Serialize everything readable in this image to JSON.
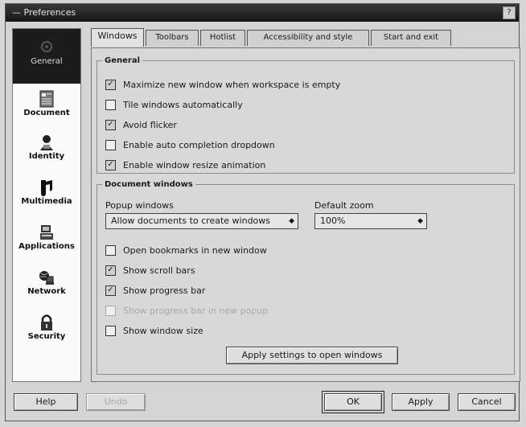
{
  "window": {
    "title": "Preferences",
    "close_label": "?"
  },
  "sidebar": {
    "items": [
      {
        "label": "General",
        "icon": "general-icon"
      },
      {
        "label": "Document",
        "icon": "document-icon"
      },
      {
        "label": "Identity",
        "icon": "identity-icon"
      },
      {
        "label": "Multimedia",
        "icon": "multimedia-icon"
      },
      {
        "label": "Applications",
        "icon": "applications-icon"
      },
      {
        "label": "Network",
        "icon": "network-icon"
      },
      {
        "label": "Security",
        "icon": "security-icon"
      }
    ],
    "selected": "General"
  },
  "tabs": [
    "Windows",
    "Toolbars",
    "Hotlist",
    "Accessibility and style",
    "Start and exit"
  ],
  "selected_tab": "Windows",
  "general": {
    "legend": "General",
    "options": [
      {
        "label": "Maximize new window when workspace is empty",
        "checked": true
      },
      {
        "label": "Tile windows automatically",
        "checked": false
      },
      {
        "label": "Avoid flicker",
        "checked": true
      },
      {
        "label": "Enable auto completion dropdown",
        "checked": false
      },
      {
        "label": "Enable window resize animation",
        "checked": true
      }
    ]
  },
  "document_windows": {
    "legend": "Document windows",
    "popup_label": "Popup windows",
    "popup_value": "Allow documents to create windows",
    "zoom_label": "Default zoom",
    "zoom_value": "100%",
    "options": [
      {
        "label": "Open bookmarks in new window",
        "checked": false,
        "enabled": true
      },
      {
        "label": "Show scroll bars",
        "checked": true,
        "enabled": true
      },
      {
        "label": "Show progress bar",
        "checked": true,
        "enabled": true
      },
      {
        "label": "Show progress bar in new popup",
        "checked": false,
        "enabled": false
      },
      {
        "label": "Show window size",
        "checked": false,
        "enabled": true
      }
    ],
    "apply_button": "Apply settings to open windows"
  },
  "footer": {
    "help": "Help",
    "undo": "Undo",
    "ok": "OK",
    "apply": "Apply",
    "cancel": "Cancel"
  }
}
